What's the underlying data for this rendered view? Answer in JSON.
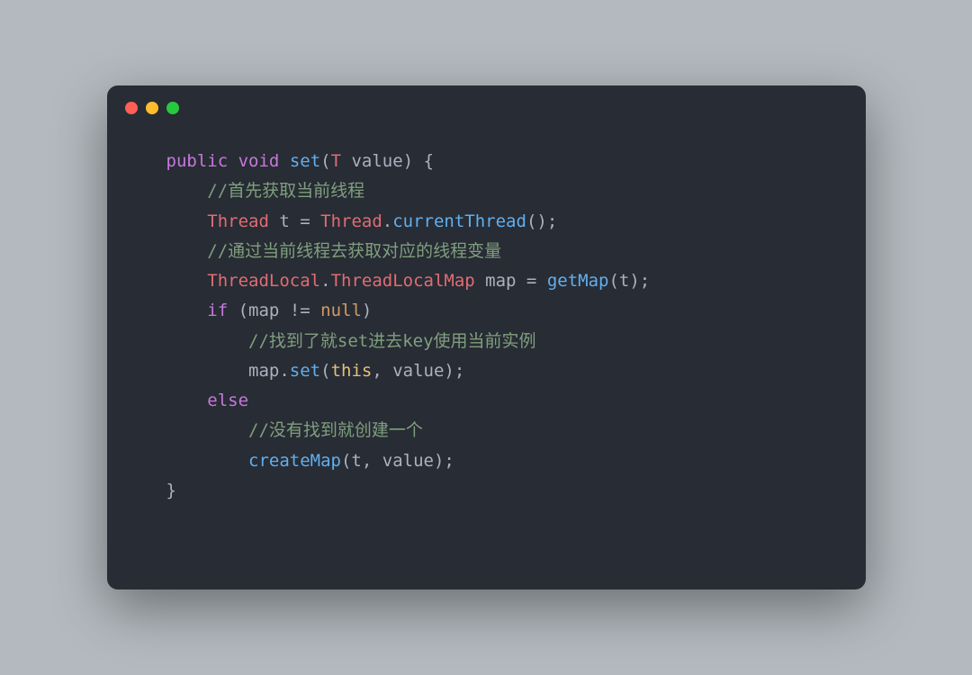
{
  "window": {
    "dots": [
      "red",
      "yellow",
      "green"
    ]
  },
  "code": {
    "l1_public": "public",
    "l1_void": "void",
    "l1_set": "set",
    "l1_paren_open": "(",
    "l1_T": "T",
    "l1_value": " value",
    "l1_paren_close": ")",
    "l1_brace": " {",
    "l2_comment": "//首先获取当前线程",
    "l3_Thread": "Thread",
    "l3_t": " t ",
    "l3_eq": "=",
    "l3_Thread2": " Thread",
    "l3_dot": ".",
    "l3_currentThread": "currentThread",
    "l3_parens": "();",
    "l4_comment": "//通过当前线程去获取对应的线程变量",
    "l5_ThreadLocal": "ThreadLocal",
    "l5_dot1": ".",
    "l5_ThreadLocalMap": "ThreadLocalMap",
    "l5_map": " map ",
    "l5_eq": "=",
    "l5_getMap": " getMap",
    "l5_paren_open": "(",
    "l5_t": "t",
    "l5_paren_close": ");",
    "l6_if": "if",
    "l6_paren_open": " (",
    "l6_map": "map",
    "l6_ne": " != ",
    "l6_null": "null",
    "l6_paren_close": ")",
    "l7_comment": "//找到了就set进去key使用当前实例",
    "l8_map": "map",
    "l8_dot": ".",
    "l8_set": "set",
    "l8_paren_open": "(",
    "l8_this": "this",
    "l8_comma": ", value);",
    "l9_else": "else",
    "l10_comment": "//没有找到就创建一个",
    "l11_createMap": "createMap",
    "l11_paren_open": "(",
    "l11_t": "t",
    "l11_rest": ", value);",
    "l12_brace": "}"
  }
}
